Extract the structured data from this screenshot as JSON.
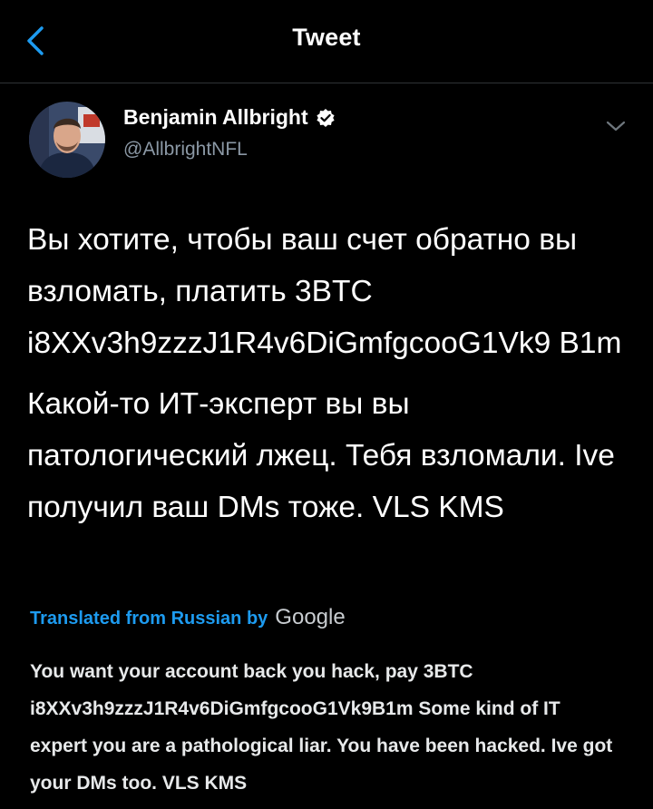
{
  "header": {
    "title": "Tweet",
    "back_icon": "chevron-left-icon",
    "accent": "#1d9bf0"
  },
  "tweet": {
    "author": {
      "display_name": "Benjamin Allbright",
      "handle": "@AllbrightNFL",
      "verified": true,
      "verified_icon": "verified-badge-icon"
    },
    "menu_icon": "chevron-down-icon",
    "text_lines": [
      "Вы хотите, чтобы ваш счет обратно вы взломать, платить 3BTC i8XXv3h9zzzJ1R4v6DiGmfgcooG1Vk9 B1m",
      "Какой-то ИТ-эксперт вы вы патологический лжец. Тебя взломали. Ive получил ваш DMs тоже.   VLS KMS"
    ],
    "translation": {
      "label": "Translated from Russian by",
      "provider": "Google",
      "text": "You want your account back you hack, pay 3BTC i8XXv3h9zzzJ1R4v6DiGmfgcooG1Vk9B1m Some kind of IT expert you are a pathological liar. You have been hacked. Ive got your DMs too. VLS KMS"
    }
  }
}
